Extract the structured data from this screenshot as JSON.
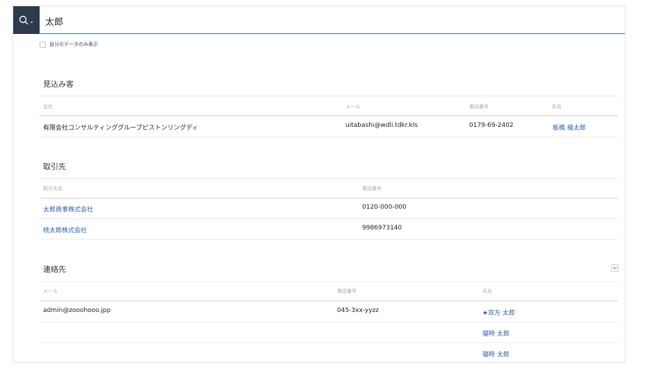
{
  "search": {
    "value": "太郎"
  },
  "filter": {
    "mine_only_label": "自分のデータのみ表示"
  },
  "leads": {
    "title": "見込み客",
    "headers": {
      "company": "会社",
      "email": "メール",
      "phone": "電話番号",
      "name": "氏名"
    },
    "rows": [
      {
        "company": "有限会社コンサルティンググループピストンリングディ",
        "email": "uitabashi@wdli.tdkr.kls",
        "phone": "0179-69-2402",
        "name": "板橋 福太郎"
      }
    ]
  },
  "accounts": {
    "title": "取引先",
    "headers": {
      "account_name": "取引先名",
      "phone": "電話番号"
    },
    "rows": [
      {
        "account_name": "太郎商事株式会社",
        "phone": "0120-000-000"
      },
      {
        "account_name": "桃太郎株式会社",
        "phone": "9986973140"
      }
    ]
  },
  "contacts": {
    "title": "連絡先",
    "headers": {
      "email": "メール",
      "phone": "電話番号",
      "name": "氏名"
    },
    "rows": [
      {
        "email": "admin@zooohooo.jpp",
        "phone": "045-3xx-yyzz",
        "name": "★双方 太郎"
      },
      {
        "email": "",
        "phone": "",
        "name": "寝時 太郎"
      },
      {
        "email": "",
        "phone": "",
        "name": "寝時 太郎"
      }
    ]
  },
  "colors": {
    "header_dark": "#2e3a4d",
    "link": "#2a62a8",
    "accent_line": "#2f6fb8"
  }
}
